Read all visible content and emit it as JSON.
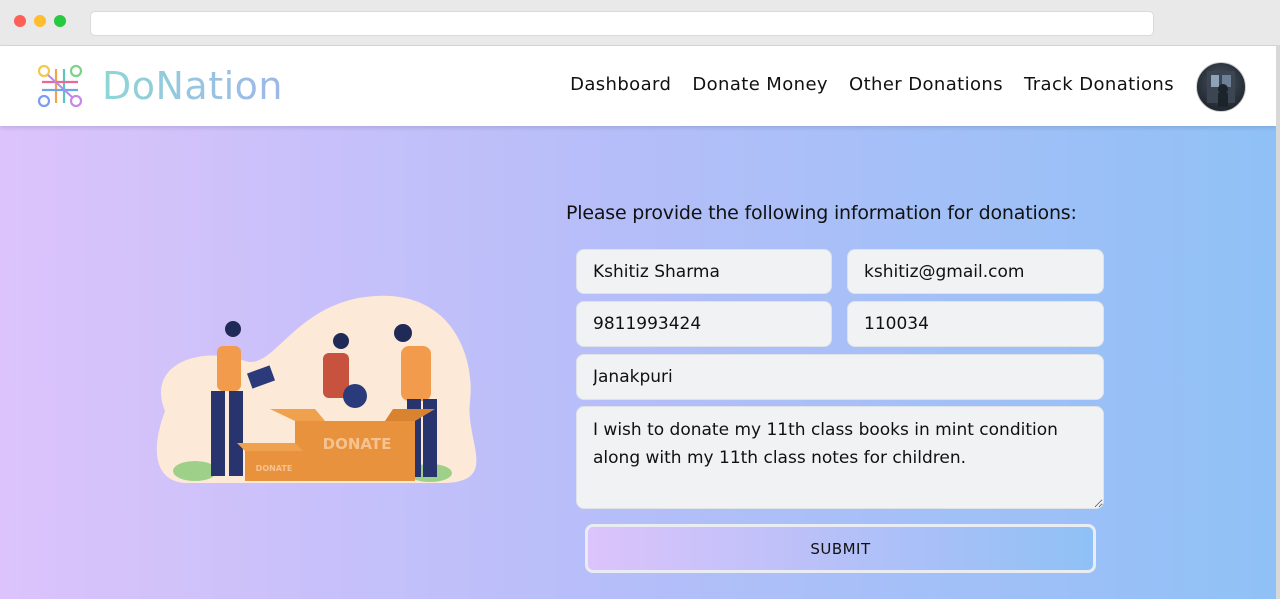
{
  "nav": {
    "brand": "DoNation",
    "links": [
      {
        "label": "Dashboard"
      },
      {
        "label": "Donate Money"
      },
      {
        "label": "Other Donations"
      },
      {
        "label": "Track Donations"
      }
    ]
  },
  "illustration": {
    "box_large_label": "DONATE",
    "box_small_label": "DONATE"
  },
  "form": {
    "title": "Please provide the following information for donations:",
    "name_value": "Kshitiz Sharma",
    "email_value": "kshitiz@gmail.com",
    "phone_value": "9811993424",
    "pincode_value": "110034",
    "address_value": "Janakpuri",
    "message_value": "I wish to donate my 11th class books in mint condition along with my 11th class notes for children.",
    "submit_label": "SUBMIT"
  },
  "colors": {
    "gradient_start": "#dcc3fb",
    "gradient_end": "#8fc1f6",
    "brand_text": "#8ed6d5"
  },
  "icons": {
    "logo": "donation-logo-icon",
    "avatar": "user-avatar"
  }
}
